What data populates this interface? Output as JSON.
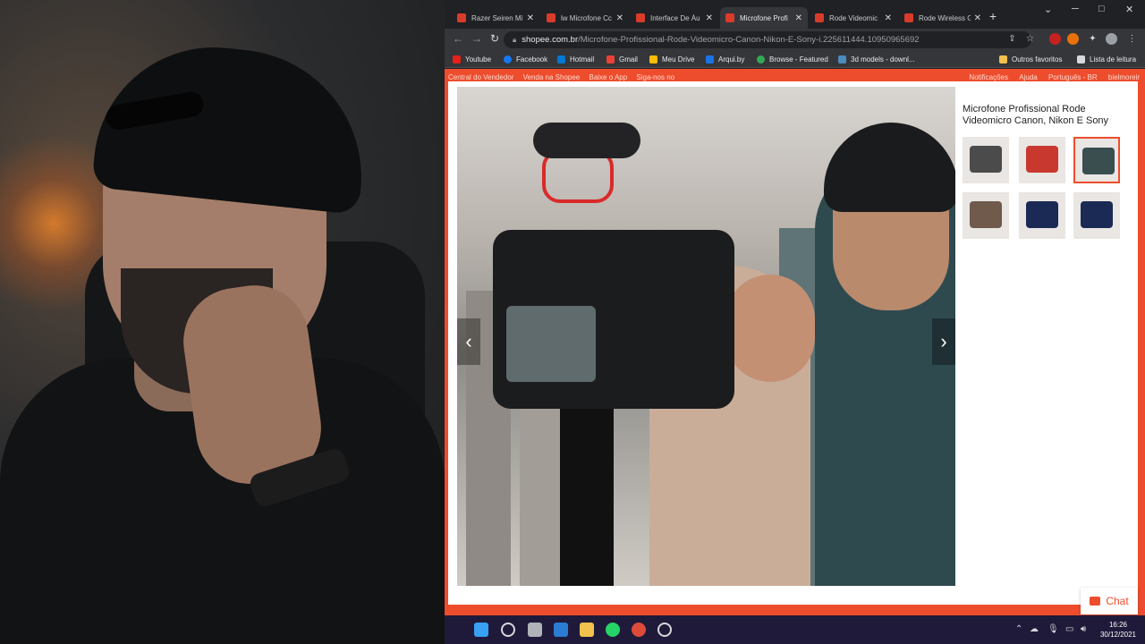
{
  "tabs": [
    {
      "label": "Razer Seiren Mi",
      "active": false
    },
    {
      "label": "lw Microfone Cc",
      "active": false
    },
    {
      "label": "Interface De Áu",
      "active": false
    },
    {
      "label": "Microfone Profi",
      "active": true
    },
    {
      "label": "Rode Videomic",
      "active": false
    },
    {
      "label": "Rode Wireless G",
      "active": false
    }
  ],
  "new_tab_label": "+",
  "address_bar": {
    "host": "shopee.com.br",
    "path": "/Microfone-Profissional-Rode-Videomicro-Canon-Nikon-E-Sony-i.225611444.10950965692"
  },
  "bookmarks": [
    {
      "label": "Youtube",
      "color": "#e62117"
    },
    {
      "label": "Facebook",
      "color": "#1877f2"
    },
    {
      "label": "Hotmail",
      "color": "#0078d4"
    },
    {
      "label": "Gmail",
      "color": "#ea4335"
    },
    {
      "label": "Meu Drive",
      "color": "#fbbc04"
    },
    {
      "label": "Arqui.by",
      "color": "#1a73e8"
    },
    {
      "label": "Browse - Featured",
      "color": "#34a853"
    },
    {
      "label": "3d models - downl...",
      "color": "#4b8bbe"
    }
  ],
  "bookmarks_right": {
    "other_favorites": "Outros favoritos",
    "reading_list": "Lista de leitura"
  },
  "shopee": {
    "topnav": [
      "Central do Vendedor",
      "Venda na Shopee",
      "Baixe o App",
      "Siga-nos no"
    ],
    "topright": [
      "Notificações",
      "Ajuda",
      "Português - BR",
      "bielmoreir"
    ],
    "product_title": "Microfone Profissional Rode Videomicro Canon, Nikon E Sony",
    "chat_label": "Chat",
    "accent_color": "#ee4d2d"
  },
  "taskbar": {
    "time": "16:26",
    "date": "30/12/2021"
  }
}
